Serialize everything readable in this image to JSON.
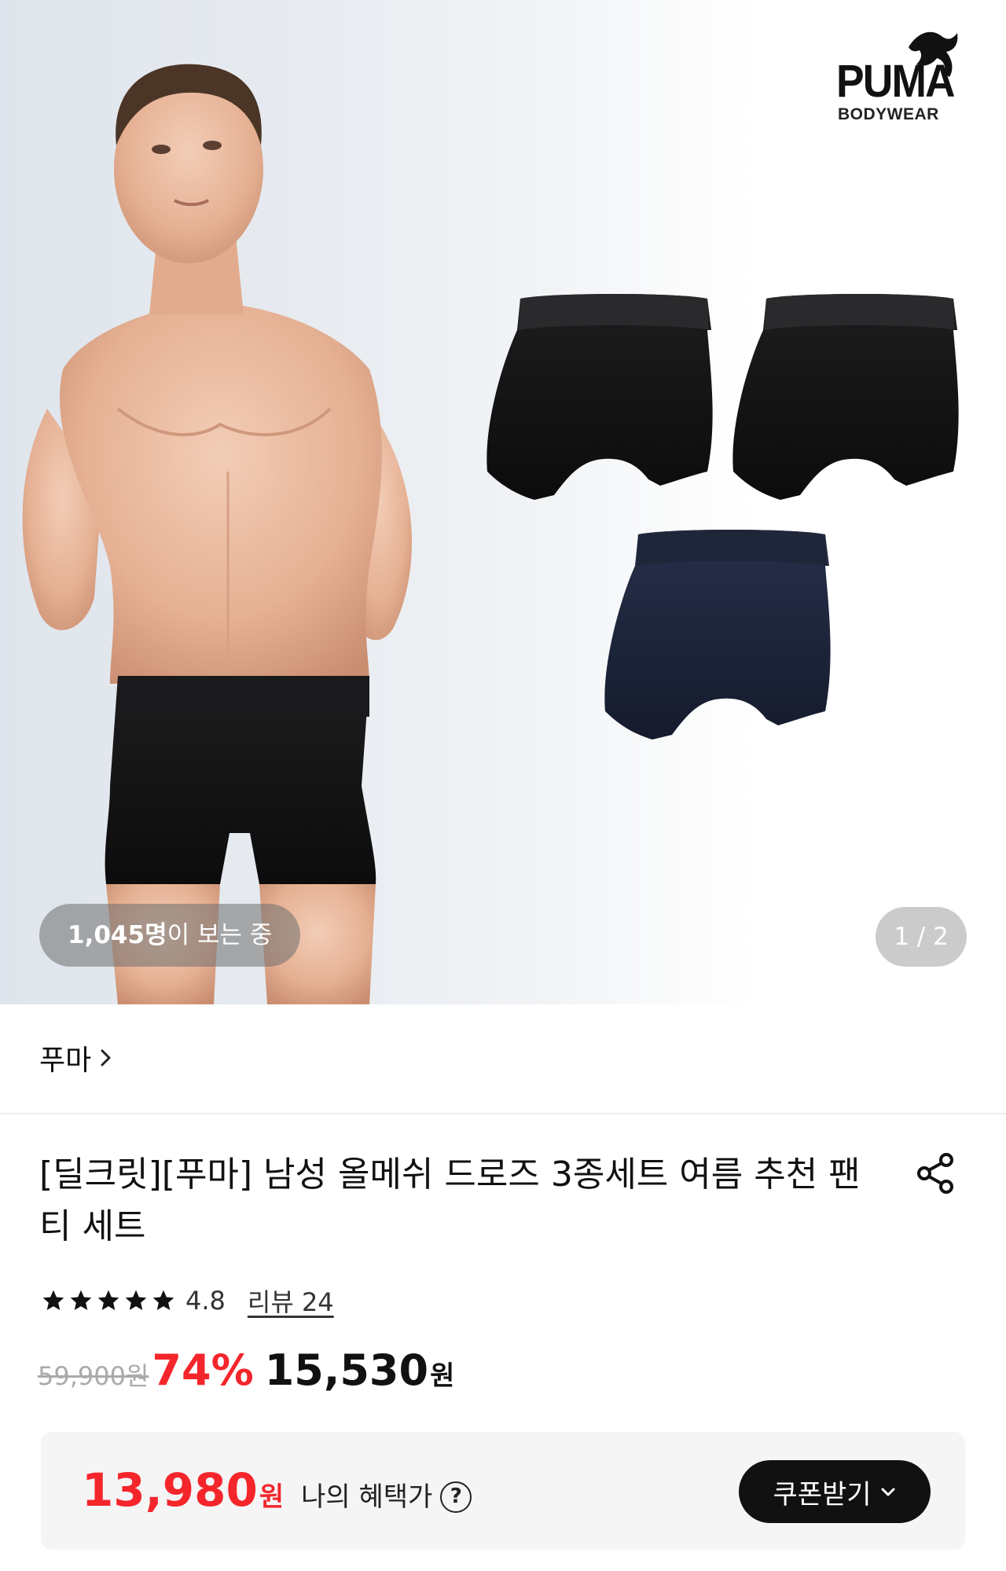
{
  "hero": {
    "brand_logo_word": "PUMA",
    "brand_logo_sub": "BODYWEAR",
    "viewers_count": "1,045명",
    "viewers_suffix": "이 보는 중",
    "page_indicator": "1 / 2"
  },
  "brand": {
    "name": "푸마"
  },
  "product": {
    "title": "[딜크릿][푸마] 남성 올메쉬 드로즈 3종세트 여름 추천 팬티 세트",
    "rating": "4.8",
    "review_label": "리뷰 24",
    "original_price": "59,900원",
    "discount": "74%",
    "sale_price": "15,530",
    "currency": "원"
  },
  "benefit": {
    "price": "13,980",
    "currency": "원",
    "label": "나의 혜택가",
    "help": "?",
    "coupon_button": "쿠폰받기"
  },
  "colors": {
    "accent_red": "#f4262b",
    "button_dark": "#111111",
    "benefit_bg": "#f5f5f6"
  },
  "icons": [
    "share-icon",
    "star-icon",
    "help-icon",
    "chevron-right-icon",
    "chevron-down-icon",
    "puma-cat-logo"
  ]
}
